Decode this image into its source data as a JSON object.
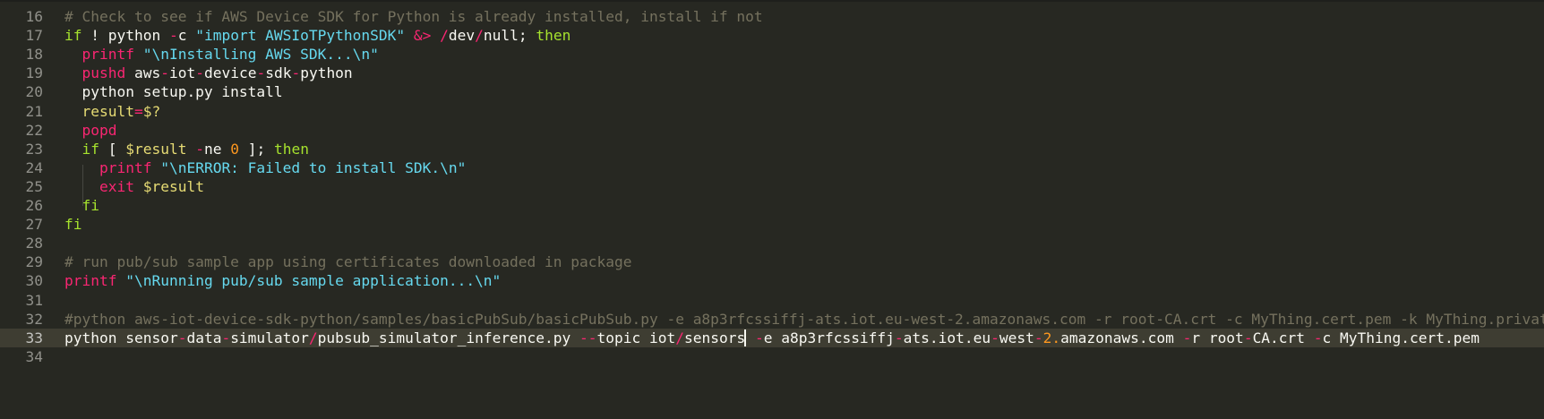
{
  "editor": {
    "theme_colors": {
      "background": "#272822",
      "active_line": "#3e3d32",
      "comment": "#75715e",
      "keyword": "#f92672",
      "string": "#66d9ef",
      "builtin": "#a6e22e",
      "variable": "#e6db74",
      "number": "#fd971f",
      "text": "#f8f8f2"
    },
    "active_line_number": "33",
    "lines": [
      {
        "num": "16",
        "tokens": [
          {
            "t": "# Check to see if AWS Device SDK for Python is already installed, install if not",
            "c": "cm"
          }
        ]
      },
      {
        "num": "17",
        "tokens": [
          {
            "t": "if",
            "c": "gr"
          },
          {
            "t": " ! python ",
            "c": ""
          },
          {
            "t": "-",
            "c": "pk"
          },
          {
            "t": "c ",
            "c": ""
          },
          {
            "t": "\"import AWSIoTPythonSDK\"",
            "c": "st"
          },
          {
            "t": " ",
            "c": ""
          },
          {
            "t": "&>",
            "c": "pk"
          },
          {
            "t": " ",
            "c": ""
          },
          {
            "t": "/",
            "c": "pk"
          },
          {
            "t": "dev",
            "c": ""
          },
          {
            "t": "/",
            "c": "pk"
          },
          {
            "t": "null; ",
            "c": ""
          },
          {
            "t": "then",
            "c": "gr"
          }
        ]
      },
      {
        "num": "18",
        "tokens": [
          {
            "t": "  ",
            "c": ""
          },
          {
            "t": "printf",
            "c": "kw"
          },
          {
            "t": " ",
            "c": ""
          },
          {
            "t": "\"\\nInstalling AWS SDK...\\n\"",
            "c": "st"
          }
        ]
      },
      {
        "num": "19",
        "tokens": [
          {
            "t": "  ",
            "c": ""
          },
          {
            "t": "pushd",
            "c": "kw"
          },
          {
            "t": " aws",
            "c": ""
          },
          {
            "t": "-",
            "c": "pk"
          },
          {
            "t": "iot",
            "c": ""
          },
          {
            "t": "-",
            "c": "pk"
          },
          {
            "t": "device",
            "c": ""
          },
          {
            "t": "-",
            "c": "pk"
          },
          {
            "t": "sdk",
            "c": ""
          },
          {
            "t": "-",
            "c": "pk"
          },
          {
            "t": "python",
            "c": ""
          }
        ]
      },
      {
        "num": "20",
        "tokens": [
          {
            "t": "  python setup.py install",
            "c": ""
          }
        ]
      },
      {
        "num": "21",
        "tokens": [
          {
            "t": "  ",
            "c": ""
          },
          {
            "t": "result",
            "c": "yl"
          },
          {
            "t": "=",
            "c": "pk"
          },
          {
            "t": "$?",
            "c": "yl"
          }
        ]
      },
      {
        "num": "22",
        "tokens": [
          {
            "t": "  ",
            "c": ""
          },
          {
            "t": "popd",
            "c": "kw"
          }
        ]
      },
      {
        "num": "23",
        "tokens": [
          {
            "t": "  ",
            "c": ""
          },
          {
            "t": "if",
            "c": "gr"
          },
          {
            "t": " [ ",
            "c": ""
          },
          {
            "t": "$result",
            "c": "yl"
          },
          {
            "t": " ",
            "c": ""
          },
          {
            "t": "-",
            "c": "pk"
          },
          {
            "t": "ne ",
            "c": ""
          },
          {
            "t": "0",
            "c": "nm"
          },
          {
            "t": " ]; ",
            "c": ""
          },
          {
            "t": "then",
            "c": "gr"
          }
        ]
      },
      {
        "num": "24",
        "tokens": [
          {
            "t": "    ",
            "c": ""
          },
          {
            "t": "printf",
            "c": "kw"
          },
          {
            "t": " ",
            "c": ""
          },
          {
            "t": "\"\\nERROR: Failed to install SDK.\\n\"",
            "c": "st"
          }
        ]
      },
      {
        "num": "25",
        "tokens": [
          {
            "t": "    ",
            "c": ""
          },
          {
            "t": "exit",
            "c": "kw"
          },
          {
            "t": " ",
            "c": ""
          },
          {
            "t": "$result",
            "c": "yl"
          }
        ]
      },
      {
        "num": "26",
        "tokens": [
          {
            "t": "  ",
            "c": ""
          },
          {
            "t": "fi",
            "c": "gr"
          }
        ]
      },
      {
        "num": "27",
        "tokens": [
          {
            "t": "fi",
            "c": "gr"
          }
        ]
      },
      {
        "num": "28",
        "tokens": []
      },
      {
        "num": "29",
        "tokens": [
          {
            "t": "# run pub/sub sample app using certificates downloaded in package",
            "c": "cm"
          }
        ]
      },
      {
        "num": "30",
        "tokens": [
          {
            "t": "printf",
            "c": "kw"
          },
          {
            "t": " ",
            "c": ""
          },
          {
            "t": "\"\\nRunning pub/sub sample application...\\n\"",
            "c": "st"
          }
        ]
      },
      {
        "num": "31",
        "tokens": []
      },
      {
        "num": "32",
        "tokens": [
          {
            "t": "#python aws-iot-device-sdk-python/samples/basicPubSub/basicPubSub.py -e a8p3rfcssiffj-ats.iot.eu-west-2.amazonaws.com -r root-CA.crt -c MyThing.cert.pem -k MyThing.private.key",
            "c": "cm"
          }
        ]
      },
      {
        "num": "33",
        "tokens": [
          {
            "t": "python sensor",
            "c": ""
          },
          {
            "t": "-",
            "c": "pk"
          },
          {
            "t": "data",
            "c": ""
          },
          {
            "t": "-",
            "c": "pk"
          },
          {
            "t": "simulator",
            "c": ""
          },
          {
            "t": "/",
            "c": "pk"
          },
          {
            "t": "pubsub_simulator_inference.py ",
            "c": ""
          },
          {
            "t": "--",
            "c": "pk"
          },
          {
            "t": "topic iot",
            "c": ""
          },
          {
            "t": "/",
            "c": "pk"
          },
          {
            "t": "sensors",
            "c": ""
          },
          {
            "t": "|CURSOR|",
            "c": "cursor"
          },
          {
            "t": " ",
            "c": ""
          },
          {
            "t": "-",
            "c": "pk"
          },
          {
            "t": "e a8p3rfcssiffj",
            "c": ""
          },
          {
            "t": "-",
            "c": "pk"
          },
          {
            "t": "ats.iot.eu",
            "c": ""
          },
          {
            "t": "-",
            "c": "pk"
          },
          {
            "t": "west",
            "c": ""
          },
          {
            "t": "-",
            "c": "pk"
          },
          {
            "t": "2.",
            "c": "nm"
          },
          {
            "t": "amazonaws.com ",
            "c": ""
          },
          {
            "t": "-",
            "c": "pk"
          },
          {
            "t": "r root",
            "c": ""
          },
          {
            "t": "-",
            "c": "pk"
          },
          {
            "t": "CA.crt ",
            "c": ""
          },
          {
            "t": "-",
            "c": "pk"
          },
          {
            "t": "c MyThing.cert.pem",
            "c": ""
          }
        ]
      },
      {
        "num": "34",
        "tokens": []
      }
    ]
  }
}
